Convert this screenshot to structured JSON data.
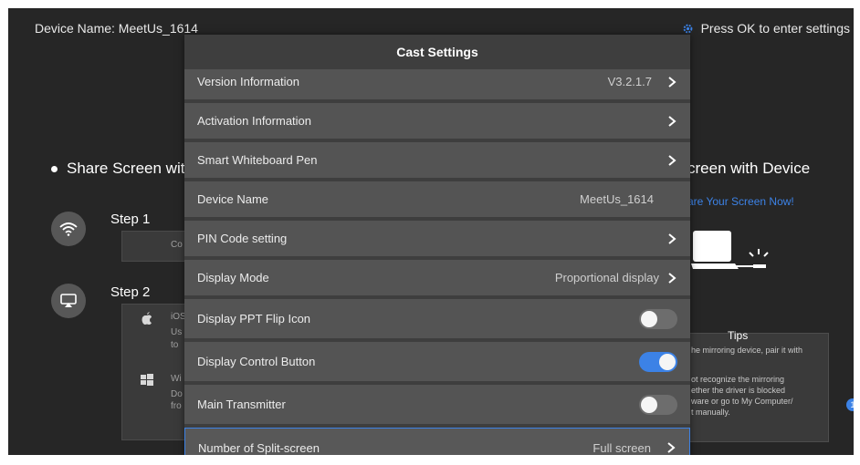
{
  "header": {
    "device_name_label": "Device Name: MeetUs_1614",
    "settings_hint": "Press OK to enter settings"
  },
  "background": {
    "share_left": "Share Screen wit",
    "share_right": "creen with Device",
    "share_now": "are Your Screen Now!",
    "step1": "Step  1",
    "step2": "Step  2",
    "step1_frag": "Co",
    "ios_frag": "iOS",
    "ios_frag2": "Us",
    "ios_frag3": "to",
    "win_frag": "Wi",
    "win_frag2": "Do",
    "win_frag3": "fro",
    "tips_title": "Tips",
    "tips_lines": [
      "he mirroring device, pair it with",
      "ot recognize the mirroring",
      "ether the driver is blocked",
      "ware or go to My Computer/",
      "t manually."
    ],
    "side_dot": "1"
  },
  "dialog": {
    "title": "Cast Settings",
    "rows": [
      {
        "label": "Version Information",
        "value": "V3.2.1.7"
      },
      {
        "label": "Activation Information",
        "value": ""
      },
      {
        "label": "Smart Whiteboard Pen",
        "value": ""
      },
      {
        "label": "Device Name",
        "value": "MeetUs_1614"
      },
      {
        "label": "PIN Code setting",
        "value": ""
      },
      {
        "label": "Display Mode",
        "value": "Proportional display"
      },
      {
        "label": "Display PPT Flip Icon",
        "toggle": "off"
      },
      {
        "label": "Display Control Button",
        "toggle": "on"
      },
      {
        "label": "Main Transmitter",
        "toggle": "off"
      },
      {
        "label": "Number of Split-screen",
        "value": "Full screen"
      }
    ]
  },
  "colors": {
    "accent": "#3c82e6",
    "row_bg": "#545454",
    "dialog_bg": "#3e3e3e"
  }
}
